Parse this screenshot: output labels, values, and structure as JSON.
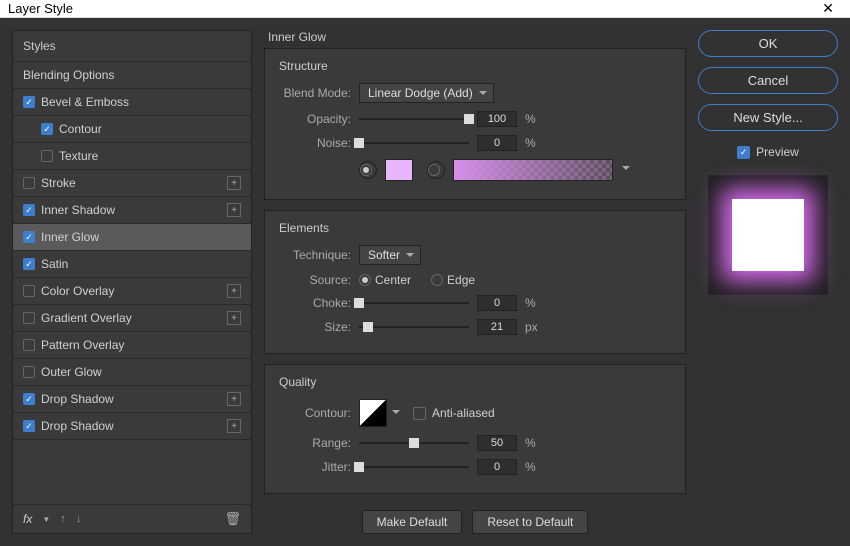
{
  "window": {
    "title": "Layer Style"
  },
  "sidebar": {
    "header": "Styles",
    "blending": "Blending Options",
    "items": [
      {
        "label": "Bevel & Emboss",
        "checked": true,
        "plus": false
      },
      {
        "label": "Contour",
        "checked": true,
        "plus": false,
        "sub": true
      },
      {
        "label": "Texture",
        "checked": false,
        "plus": false,
        "sub": true
      },
      {
        "label": "Stroke",
        "checked": false,
        "plus": true
      },
      {
        "label": "Inner Shadow",
        "checked": true,
        "plus": true
      },
      {
        "label": "Inner Glow",
        "checked": true,
        "plus": false,
        "selected": true
      },
      {
        "label": "Satin",
        "checked": true,
        "plus": false
      },
      {
        "label": "Color Overlay",
        "checked": false,
        "plus": true
      },
      {
        "label": "Gradient Overlay",
        "checked": false,
        "plus": true
      },
      {
        "label": "Pattern Overlay",
        "checked": false,
        "plus": false
      },
      {
        "label": "Outer Glow",
        "checked": false,
        "plus": false
      },
      {
        "label": "Drop Shadow",
        "checked": true,
        "plus": true
      },
      {
        "label": "Drop Shadow",
        "checked": true,
        "plus": true
      }
    ],
    "fx": "fx"
  },
  "main": {
    "title": "Inner Glow",
    "structure": {
      "head": "Structure",
      "blendmode_lbl": "Blend Mode:",
      "blendmode": "Linear Dodge (Add)",
      "opacity_lbl": "Opacity:",
      "opacity": "100",
      "opacity_unit": "%",
      "noise_lbl": "Noise:",
      "noise": "0",
      "noise_unit": "%",
      "color": "#e8b5ff"
    },
    "elements": {
      "head": "Elements",
      "technique_lbl": "Technique:",
      "technique": "Softer",
      "source_lbl": "Source:",
      "center": "Center",
      "edge": "Edge",
      "choke_lbl": "Choke:",
      "choke": "0",
      "choke_unit": "%",
      "size_lbl": "Size:",
      "size": "21",
      "size_unit": "px"
    },
    "quality": {
      "head": "Quality",
      "contour_lbl": "Contour:",
      "aa": "Anti-aliased",
      "range_lbl": "Range:",
      "range": "50",
      "range_unit": "%",
      "jitter_lbl": "Jitter:",
      "jitter": "0",
      "jitter_unit": "%"
    },
    "buttons": {
      "default": "Make Default",
      "reset": "Reset to Default"
    }
  },
  "right": {
    "ok": "OK",
    "cancel": "Cancel",
    "newstyle": "New Style...",
    "preview": "Preview"
  }
}
